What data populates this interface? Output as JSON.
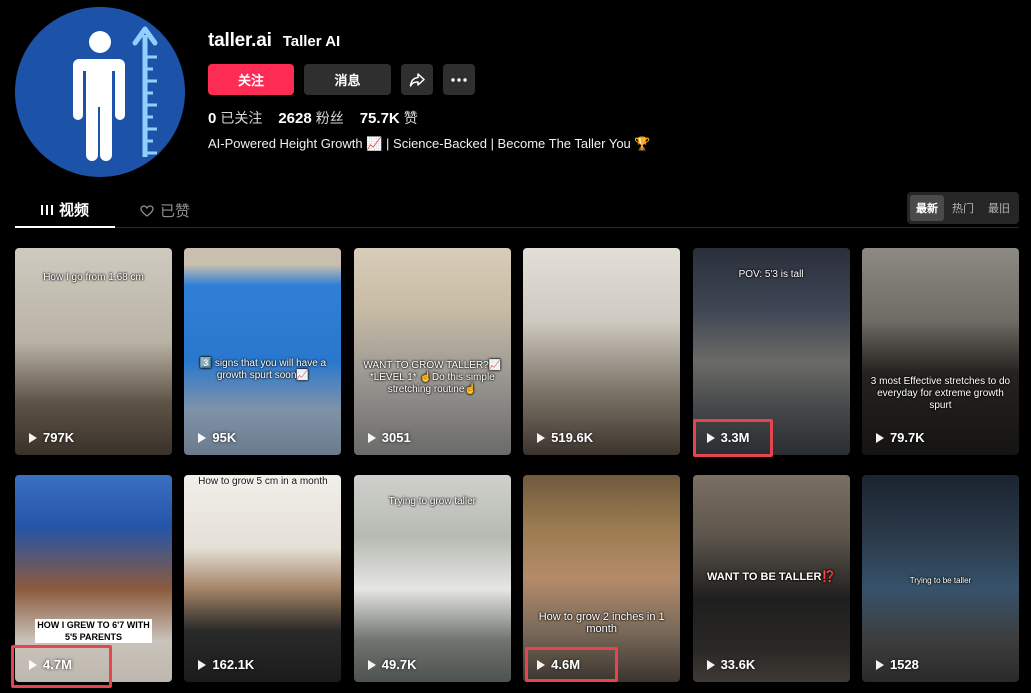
{
  "profile": {
    "username": "taller.ai",
    "nickname": "Taller AI",
    "follow_label": "关注",
    "message_label": "消息",
    "stats": [
      {
        "count": "0",
        "label": "已关注"
      },
      {
        "count": "2628",
        "label": "粉丝"
      },
      {
        "count": "75.7K",
        "label": "赞"
      }
    ],
    "bio": "AI-Powered Height Growth 📈 | Science-Backed | Become The Taller You 🏆"
  },
  "tabs": {
    "videos": "视频",
    "liked": "已赞"
  },
  "sort": [
    "最新",
    "热门",
    "最旧"
  ],
  "videos": [
    {
      "views": "797K",
      "caption": "How I go from 1.68 cm"
    },
    {
      "views": "95K",
      "caption": "3️⃣ signs that you will have a growth spurt soon📈"
    },
    {
      "views": "3051",
      "caption": "WANT TO GROW TALLER?📈 *LEVEL 1* ☝️Do this simple stretching routine☝️"
    },
    {
      "views": "519.6K",
      "caption": ""
    },
    {
      "views": "3.3M",
      "caption": "POV: 5'3 is tall"
    },
    {
      "views": "79.7K",
      "caption": "3 most Effective stretches to do everyday for extreme growth spurt"
    },
    {
      "views": "4.7M",
      "caption": "HOW I GREW TO 6'7 WITH 5'5 PARENTS"
    },
    {
      "views": "162.1K",
      "caption": "How to grow 5 cm in a month"
    },
    {
      "views": "49.7K",
      "caption": "Trying to grow taller"
    },
    {
      "views": "4.6M",
      "caption": "How to grow 2 inches in 1 month"
    },
    {
      "views": "33.6K",
      "caption": "WANT TO BE TALLER⁉️"
    },
    {
      "views": "1528",
      "caption": "Trying to be taller"
    }
  ],
  "colors": {
    "accent": "#fe2c55",
    "highlight_box": "#e64550",
    "avatar_bg": "#1c53a8"
  }
}
